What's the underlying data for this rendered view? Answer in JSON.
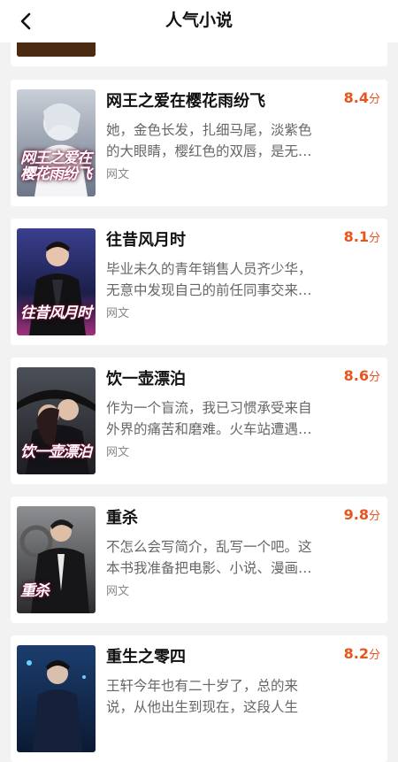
{
  "header": {
    "title": "人气小说",
    "back_icon": "chevron-left-icon"
  },
  "accent_color": "#e8541e",
  "books": [
    {
      "name": "网王之爱在樱花雨纷飞",
      "score": "8.4",
      "score_unit": "分",
      "desc_line1": "她，金色长发，扎细马尾，淡紫色",
      "desc_line2": "的大眼睛，樱红色的双唇，是无…",
      "tag": "网文",
      "cover_title": "网王之爱在樱花雨纷飞"
    },
    {
      "name": "往昔风月时",
      "score": "8.1",
      "score_unit": "分",
      "desc_line1": "毕业未久的青年销售人员齐少华，",
      "desc_line2": "无意中发现自己的前任同事交来…",
      "tag": "网文",
      "cover_title": "往昔风月时"
    },
    {
      "name": "饮一壶漂泊",
      "score": "8.6",
      "score_unit": "分",
      "desc_line1": "作为一个盲流，我已习惯承受来自",
      "desc_line2": "外界的痛苦和磨难。火车站遭遇…",
      "tag": "网文",
      "cover_title": "饮一壶漂泊"
    },
    {
      "name": "重杀",
      "score": "9.8",
      "score_unit": "分",
      "desc_line1": "不怎么会写简介，乱写一个吧。这",
      "desc_line2": "本书我准备把电影、小说、漫画…",
      "tag": "网文",
      "cover_title": "重杀"
    },
    {
      "name": "重生之零四",
      "score": "8.2",
      "score_unit": "分",
      "desc_line1": "王轩今年也有二十岁了，总的来",
      "desc_line2": "说，从他出生到现在，这段人生",
      "tag": "网文",
      "cover_title": ""
    }
  ]
}
